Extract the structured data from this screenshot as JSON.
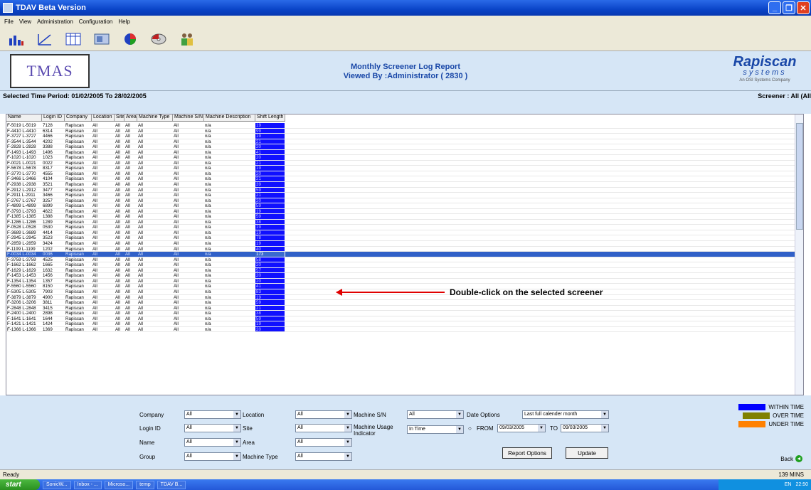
{
  "window": {
    "title": "TDAV Beta Version"
  },
  "menu": [
    "File",
    "View",
    "Administration",
    "Configuration",
    "Help"
  ],
  "toolbar_icons": [
    "bar-chart-icon",
    "line-chart-icon",
    "table-icon",
    "report-icon",
    "pie-chart-icon",
    "disc-icon",
    "users-icon"
  ],
  "header": {
    "logo_text": "TMAS",
    "title_line1": "Monthly Screener Log Report",
    "title_line2": "Viewed By :Administrator  ( 2830 )",
    "brand": "Rapiscan",
    "brand_sub": "systems",
    "brand_tag": "An OSI Systems Company"
  },
  "period": "Selected Time Period: 01/02/2005 To 28/02/2005",
  "screener_label": "Screener : All (All",
  "columns": [
    "Name",
    "Login ID",
    "Company",
    "Location",
    "Site",
    "Area",
    "Machine Type",
    "Machine S/N",
    "Machine Description",
    "Shift Length"
  ],
  "rows": [
    [
      "F-5019 L-5019",
      "7128",
      "Rapiscan",
      "All",
      "All",
      "All",
      "All",
      "All",
      "n/a",
      "19"
    ],
    [
      "F-4410 L-4410",
      "6314",
      "Rapiscan",
      "All",
      "All",
      "All",
      "All",
      "All",
      "n/a",
      "99"
    ],
    [
      "F-3727 L-3727",
      "4466",
      "Rapiscan",
      "All",
      "All",
      "All",
      "All",
      "All",
      "n/a",
      "19"
    ],
    [
      "F-3544 L-3544",
      "4202",
      "Rapiscan",
      "All",
      "All",
      "All",
      "All",
      "All",
      "n/a",
      "21"
    ],
    [
      "F-2828 L-2828",
      "3388",
      "Rapiscan",
      "All",
      "All",
      "All",
      "All",
      "All",
      "n/a",
      "20"
    ],
    [
      "F-1493 L-1493",
      "1496",
      "Rapiscan",
      "All",
      "All",
      "All",
      "All",
      "All",
      "n/a",
      "41"
    ],
    [
      "F-1020 L-1020",
      "1023",
      "Rapiscan",
      "All",
      "All",
      "All",
      "All",
      "All",
      "n/a",
      "20"
    ],
    [
      "F-0021 L-0021",
      "0022",
      "Rapiscan",
      "All",
      "All",
      "All",
      "All",
      "All",
      "n/a",
      "21"
    ],
    [
      "F-5678 L-5678",
      "8317",
      "Rapiscan",
      "All",
      "All",
      "All",
      "All",
      "All",
      "n/a",
      "19"
    ],
    [
      "F-3770 L-3770",
      "4555",
      "Rapiscan",
      "All",
      "All",
      "All",
      "All",
      "All",
      "n/a",
      "20"
    ],
    [
      "F-3466 L-3466",
      "4104",
      "Rapiscan",
      "All",
      "All",
      "All",
      "All",
      "All",
      "n/a",
      "21"
    ],
    [
      "F-2938 L-2938",
      "3521",
      "Rapiscan",
      "All",
      "All",
      "All",
      "All",
      "All",
      "n/a",
      "39"
    ],
    [
      "F-2912 L-2912",
      "3477",
      "Rapiscan",
      "All",
      "All",
      "All",
      "All",
      "All",
      "n/a",
      "59"
    ],
    [
      "F-2911 L-2911",
      "3466",
      "Rapiscan",
      "All",
      "All",
      "All",
      "All",
      "All",
      "n/a",
      "21"
    ],
    [
      "F-2767 L-2767",
      "3257",
      "Rapiscan",
      "All",
      "All",
      "All",
      "All",
      "All",
      "n/a",
      "20"
    ],
    [
      "F-4899 L-4899",
      "6899",
      "Rapiscan",
      "All",
      "All",
      "All",
      "All",
      "All",
      "n/a",
      "59"
    ],
    [
      "F-3793 L-3793",
      "4622",
      "Rapiscan",
      "All",
      "All",
      "All",
      "All",
      "All",
      "n/a",
      "19"
    ],
    [
      "F-1385 L-1385",
      "1388",
      "Rapiscan",
      "All",
      "All",
      "All",
      "All",
      "All",
      "n/a",
      "59"
    ],
    [
      "F-1286 L-1286",
      "1289",
      "Rapiscan",
      "All",
      "All",
      "All",
      "All",
      "All",
      "n/a",
      "38"
    ],
    [
      "F-0528 L-0528",
      "0530",
      "Rapiscan",
      "All",
      "All",
      "All",
      "All",
      "All",
      "n/a",
      "19"
    ],
    [
      "F-3689 L-3689",
      "4414",
      "Rapiscan",
      "All",
      "All",
      "All",
      "All",
      "All",
      "n/a",
      "19"
    ],
    [
      "F-2945 L-2945",
      "3523",
      "Rapiscan",
      "All",
      "All",
      "All",
      "All",
      "All",
      "n/a",
      "78"
    ],
    [
      "F-2859 L-2859",
      "3424",
      "Rapiscan",
      "All",
      "All",
      "All",
      "All",
      "All",
      "n/a",
      "19"
    ],
    [
      "F-1199 L-1199",
      "1202",
      "Rapiscan",
      "All",
      "All",
      "All",
      "All",
      "All",
      "n/a",
      "40"
    ],
    [
      "F-0034 L-0034",
      "0036",
      "Rapiscan",
      "All",
      "All",
      "All",
      "All",
      "All",
      "n/a",
      "173"
    ],
    [
      "F-3759 L-3759",
      "4525",
      "Rapiscan",
      "All",
      "All",
      "All",
      "All",
      "All",
      "n/a",
      "58"
    ],
    [
      "F-1662 L-1662",
      "1665",
      "Rapiscan",
      "All",
      "All",
      "All",
      "All",
      "All",
      "n/a",
      "20"
    ],
    [
      "F-1629 L-1629",
      "1632",
      "Rapiscan",
      "All",
      "All",
      "All",
      "All",
      "All",
      "n/a",
      "57"
    ],
    [
      "F-1453 L-1453",
      "1456",
      "Rapiscan",
      "All",
      "All",
      "All",
      "All",
      "All",
      "n/a",
      "20"
    ],
    [
      "F-1354 L-1354",
      "1357",
      "Rapiscan",
      "All",
      "All",
      "All",
      "All",
      "All",
      "n/a",
      "20"
    ],
    [
      "F-5560 L-5560",
      "8150",
      "Rapiscan",
      "All",
      "All",
      "All",
      "All",
      "All",
      "n/a",
      "41"
    ],
    [
      "F-5305 L-5305",
      "7903",
      "Rapiscan",
      "All",
      "All",
      "All",
      "All",
      "All",
      "n/a",
      "83"
    ],
    [
      "F-3879 L-3879",
      "4900",
      "Rapiscan",
      "All",
      "All",
      "All",
      "All",
      "All",
      "n/a",
      "19"
    ],
    [
      "F-3206 L-3206",
      "3811",
      "Rapiscan",
      "All",
      "All",
      "All",
      "All",
      "All",
      "n/a",
      "59"
    ],
    [
      "F-2848 L-2848",
      "3415",
      "Rapiscan",
      "All",
      "All",
      "All",
      "All",
      "All",
      "n/a",
      "21"
    ],
    [
      "F-2400 L-2400",
      "2898",
      "Rapiscan",
      "All",
      "All",
      "All",
      "All",
      "All",
      "n/a",
      "38"
    ],
    [
      "F-1641 L-1641",
      "1644",
      "Rapiscan",
      "All",
      "All",
      "All",
      "All",
      "All",
      "n/a",
      "59"
    ],
    [
      "F-1421 L-1421",
      "1424",
      "Rapiscan",
      "All",
      "All",
      "All",
      "All",
      "All",
      "n/a",
      "19"
    ],
    [
      "F-1366 L-1366",
      "1369",
      "Rapiscan",
      "All",
      "All",
      "All",
      "All",
      "All",
      "n/a",
      "20"
    ]
  ],
  "selected_row": 24,
  "annotation": "Double-click on the selected screener",
  "filters": {
    "company_label": "Company",
    "company": "All",
    "login_label": "Login ID",
    "login": "All",
    "name_label": "Name",
    "name": "All",
    "group_label": "Group",
    "group": "All",
    "location_label": "Location",
    "location": "All",
    "site_label": "Site",
    "site": "All",
    "area_label": "Area",
    "area": "All",
    "mtype_label": "Machine Type",
    "mtype": "All",
    "msn_label": "Machine S/N",
    "msn": "All",
    "usage_label": "Machine Usage Indicator",
    "usage": "In Time",
    "date_label": "Date Options",
    "date_option": "Last full calender month",
    "from_label": "FROM",
    "from": "09/03/2005",
    "to_label": "TO",
    "to": "09/03/2005",
    "report_options": "Report Options",
    "update": "Update"
  },
  "legend": [
    {
      "label": "WITHIN TIME",
      "color": "#0000ff"
    },
    {
      "label": "OVER TIME",
      "color": "#808000"
    },
    {
      "label": "UNDER TIME",
      "color": "#ff8000"
    }
  ],
  "back_label": "Back",
  "status": {
    "text": "Ready",
    "right": "139 MINS"
  },
  "taskbar": {
    "start": "start",
    "tasks": [
      "SonicW...",
      "Inbox - ...",
      "Microso...",
      "temp",
      "TDAV B..."
    ],
    "tray": "EN",
    "clock": "22:50"
  }
}
